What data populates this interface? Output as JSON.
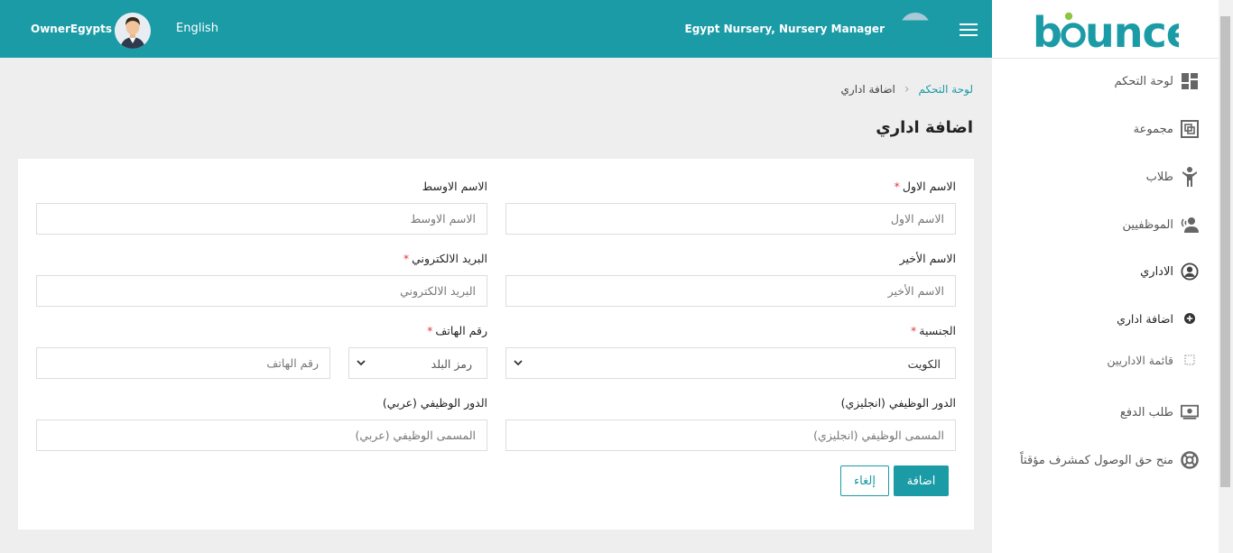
{
  "topbar": {
    "user_name": "OwnerEgypts",
    "language": "English",
    "nursery_role": "Egypt Nursery, Nursery Manager"
  },
  "brand": {
    "logo_text": "bounce",
    "accent": "#1a9ba6"
  },
  "sidebar": {
    "items": [
      {
        "label": "لوحة التحكم",
        "icon": "dashboard-icon"
      },
      {
        "label": "مجموعة",
        "icon": "group-icon"
      },
      {
        "label": "طلاب",
        "icon": "student-icon"
      },
      {
        "label": "الموظفيين",
        "icon": "staff-icon"
      },
      {
        "label": "الاداري",
        "icon": "admin-user-icon"
      },
      {
        "label": "اضافة اداري",
        "icon": "add-circle-icon"
      },
      {
        "label": "قائمة الاداريين",
        "icon": "list-square-icon"
      },
      {
        "label": "طلب الدفع",
        "icon": "payment-icon"
      },
      {
        "label": "منح حق الوصول كمشرف مؤقتاً",
        "icon": "lifebuoy-icon"
      }
    ]
  },
  "breadcrumb": {
    "home": "لوحة التحكم",
    "current": "اضافة اداري"
  },
  "page_title": "اضافة اداري",
  "form": {
    "first_name": {
      "label": "الاسم الاول",
      "placeholder": "الاسم الاول",
      "required": "*"
    },
    "middle_name": {
      "label": "الاسم الاوسط",
      "placeholder": "الاسم الاوسط"
    },
    "last_name": {
      "label": "الاسم الأخير",
      "placeholder": "الاسم الأخير"
    },
    "email": {
      "label": "البريد الالكتروني",
      "placeholder": "البريد الالكتروني",
      "required": "*"
    },
    "nationality": {
      "label": "الجنسية",
      "value": "الكويت",
      "required": "*"
    },
    "phone": {
      "label": "رقم الهاتف",
      "country_code_placeholder": "رمز البلد",
      "placeholder": "رقم الهاتف",
      "required": "*"
    },
    "role_en": {
      "label": "الدور الوظيفي (انجليزي)",
      "placeholder": "المسمى الوظيفي (انجليزي)"
    },
    "role_ar": {
      "label": "الدور الوظيفي (عربي)",
      "placeholder": "المسمى الوظيفي (عربي)"
    },
    "add_label": "اضافة",
    "cancel_label": "إلغاء"
  }
}
